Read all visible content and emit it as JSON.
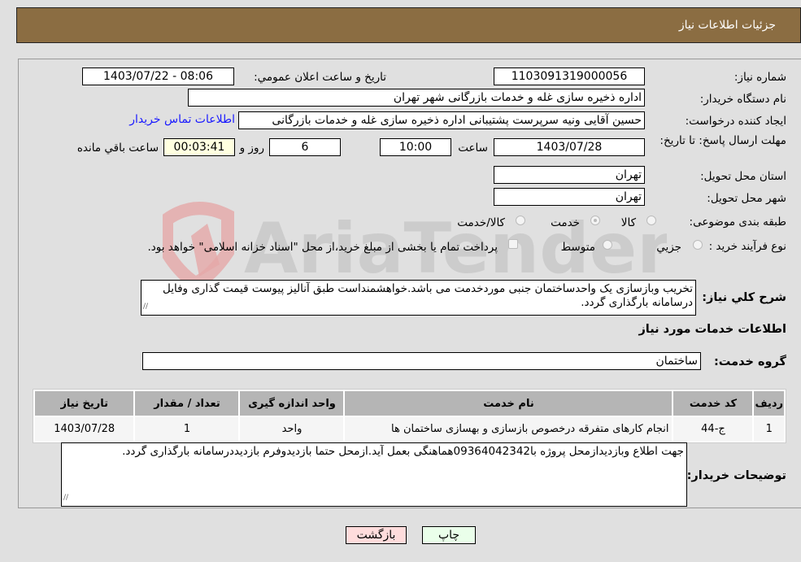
{
  "header": {
    "title": "جزئیات اطلاعات نیاز"
  },
  "fields": {
    "need_number": {
      "label": "شماره نیاز:",
      "value": "1103091319000056"
    },
    "announce_datetime": {
      "label": "تاریخ و ساعت اعلان عمومي:",
      "value": "1403/07/22 - 08:06"
    },
    "buyer_org": {
      "label": "نام دستگاه خریدار:",
      "value": "اداره ذخیره سازی غله و خدمات بازرگانی شهر تهران"
    },
    "requester": {
      "label": "ایجاد کننده درخواست:",
      "value": "حسین آقایی ونیه سرپرست پشتیبانی اداره ذخیره سازی غله و خدمات بازرگانی"
    },
    "contact_link": "اطلاعات تماس خریدار",
    "deadline": {
      "label": "مهلت ارسال پاسخ: تا تاریخ:",
      "date": "1403/07/28",
      "time_label": "ساعت",
      "time": "10:00",
      "days": "6",
      "days_label": "روز و",
      "remaining": "00:03:41",
      "remaining_label": "ساعت باقي مانده"
    },
    "province": {
      "label": "استان محل تحویل:",
      "value": "تهران"
    },
    "city": {
      "label": "شهر محل تحویل:",
      "value": "تهران"
    },
    "category": {
      "label": "طبقه بندی موضوعی:",
      "options": [
        "کالا",
        "خدمت",
        "کالا/خدمت"
      ],
      "selected": "خدمت"
    },
    "purchase_type": {
      "label": "نوع فرآیند خرید :",
      "options": [
        "جزيي",
        "متوسط"
      ],
      "treasury_note": "پرداخت تمام یا بخشی از مبلغ خرید،از محل \"اسناد خزانه اسلامی\" خواهد بود."
    },
    "description": {
      "label": "شرح کلي نیاز:",
      "value": "تخریب وبازسازی یک واحدساختمان جنبی موردخدمت می باشد.خواهشمنداست طبق آنالیز پیوست قیمت گذاری وفایل درسامانه بارگذاری گردد."
    }
  },
  "services": {
    "section_title": "اطلاعات خدمات مورد نیاز",
    "group_label": "گروه خدمت:",
    "group_value": "ساختمان",
    "table": {
      "columns": [
        "ردیف",
        "کد خدمت",
        "نام خدمت",
        "واحد اندازه گیری",
        "تعداد / مقدار",
        "تاریخ نیاز"
      ],
      "rows": [
        [
          "1",
          "ج-44",
          "انجام کارهای متفرقه درخصوص بازسازی و بهسازی ساختمان ها",
          "واحد",
          "1",
          "1403/07/28"
        ]
      ]
    }
  },
  "buyer_notes": {
    "label": "توضیحات خریدار:",
    "value": "جهت اطلاع وبازدیدازمحل پروژه با09364042342هماهنگی بعمل آید.ازمحل حتما بازدیدوفرم بازدیددرسامانه بارگذاری گردد."
  },
  "buttons": {
    "print": "چاپ",
    "back": "بازگشت"
  },
  "watermark": "AriaTender.neT",
  "colors": {
    "header_bg": "#8b6d42",
    "print_bg": "#eaffea",
    "back_bg": "#ffdcdc",
    "remaining_bg": "#ffffe0",
    "link": "#1a1aff"
  }
}
